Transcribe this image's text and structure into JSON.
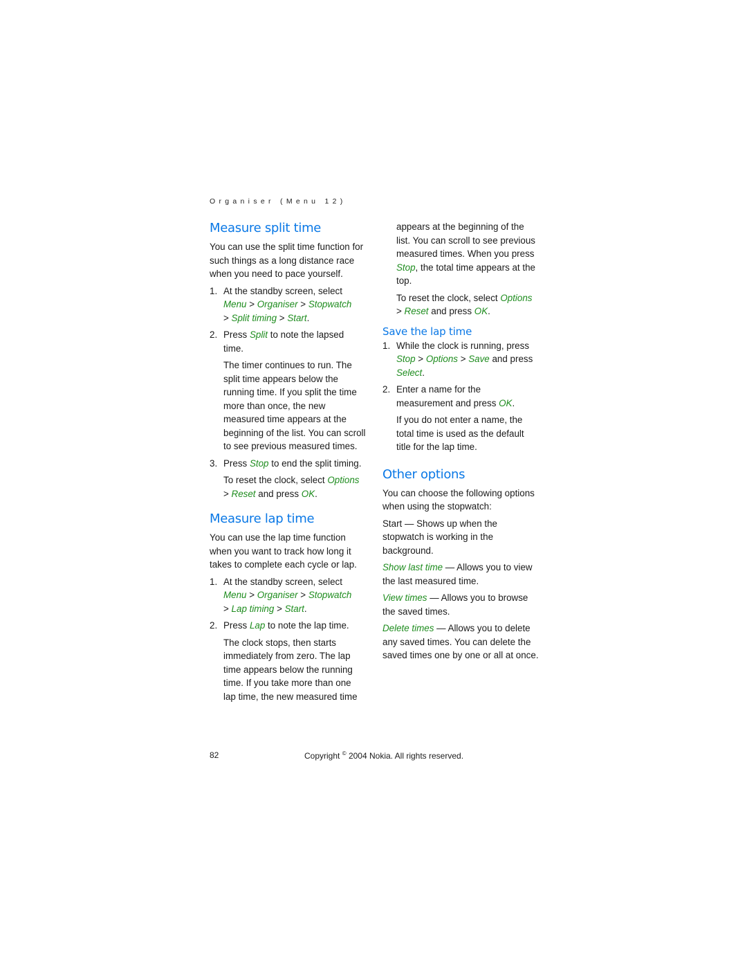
{
  "running_head": "Organiser (Menu 12)",
  "left": {
    "split": {
      "title": "Measure split time",
      "intro": "You can use the split time function for such things as a long distance race when you need to pace yourself.",
      "step1": {
        "num": "1.",
        "text": "At the standby screen, select",
        "path": [
          "Menu",
          "Organiser",
          "Stopwatch",
          "Split timing",
          "Start"
        ]
      },
      "step2": {
        "num": "2.",
        "pre": "Press ",
        "cmd": "Split",
        "post": " to note the lapsed time."
      },
      "note": "The timer continues to run. The split time appears below the running time. If you split the time more than once, the new measured time appears at the beginning of the list. You can scroll to see previous measured times.",
      "step3": {
        "num": "3.",
        "pre": "Press ",
        "cmd": "Stop",
        "post": " to end the split timing."
      },
      "reset": {
        "pre": "To reset the clock, select ",
        "opt": "Options",
        "reset": "Reset",
        "mid": " and press ",
        "ok": "OK"
      }
    },
    "lap": {
      "title": "Measure lap time",
      "intro": "You can use the lap time function when you want to track how long it takes to complete each cycle or lap.",
      "step1": {
        "num": "1.",
        "text": "At the standby screen, select",
        "path": [
          "Menu",
          "Organiser",
          "Stopwatch",
          "Lap timing",
          "Start"
        ]
      },
      "step2": {
        "num": "2.",
        "pre": "Press ",
        "cmd": "Lap",
        "post": " to note the lap time."
      },
      "note": "The clock stops, then starts immediately from zero. The lap time appears below the running time. If you take more than one lap time, the new measured time"
    }
  },
  "right": {
    "lap_cont": {
      "pre": "appears at the beginning of the list. You can scroll to see previous measured times. When you press ",
      "cmd": "Stop",
      "post": ", the total time appears at the top.",
      "reset": {
        "pre": "To reset the clock, select ",
        "opt": "Options",
        "reset": "Reset",
        "mid": " and press ",
        "ok": "OK"
      }
    },
    "save": {
      "title": "Save the lap time",
      "step1": {
        "num": "1.",
        "pre": "While the clock is running, press ",
        "path": [
          "Stop",
          "Options",
          "Save"
        ],
        "mid": " and press ",
        "select": "Select"
      },
      "step2": {
        "num": "2.",
        "pre": "Enter a name for the measurement and press ",
        "ok": "OK"
      },
      "note": "If you do not enter a name, the total time is used as the default title for the lap time."
    },
    "other": {
      "title": "Other options",
      "intro": "You can choose the following options when using the stopwatch:",
      "items": [
        {
          "term": "Start",
          "italic": false,
          "desc": " — Shows up when the stopwatch is working in the background."
        },
        {
          "term": "Show last time",
          "italic": true,
          "desc": " — Allows you to view the last measured time."
        },
        {
          "term": "View times",
          "italic": true,
          "desc": " — Allows you to browse the saved times."
        },
        {
          "term": "Delete times",
          "italic": true,
          "desc": " — Allows you to delete any saved times. You can delete the saved times one by one or all at once."
        }
      ]
    }
  },
  "footer": {
    "page": "82",
    "copyright_pre": "Copyright ",
    "copyright_sym": "©",
    "copyright_post": " 2004 Nokia. All rights reserved."
  },
  "colors": {
    "heading": "#0a78e6",
    "command": "#1e8c1e"
  }
}
